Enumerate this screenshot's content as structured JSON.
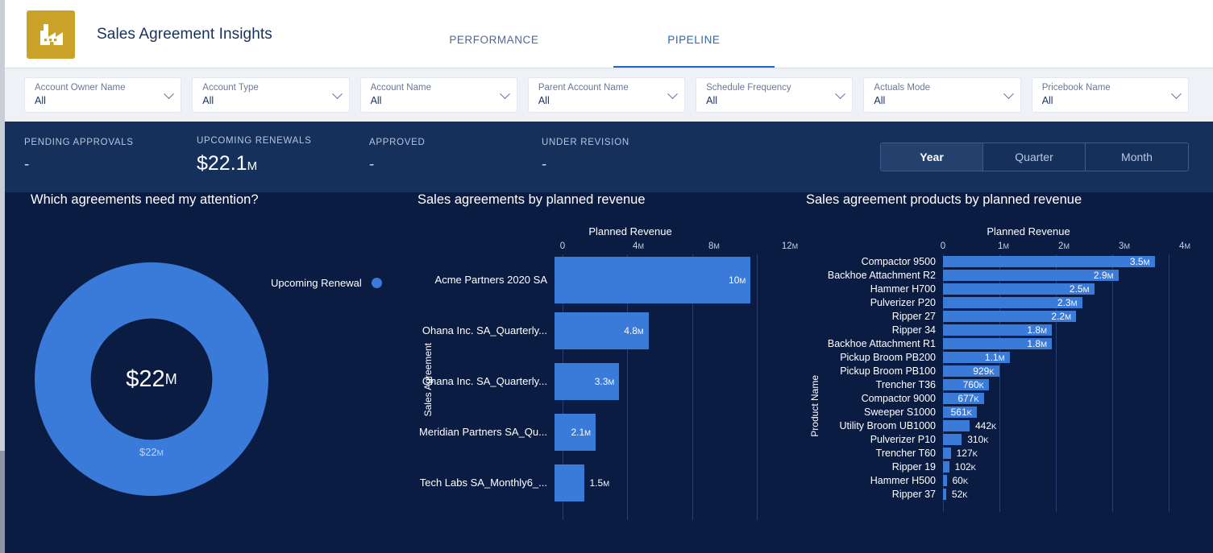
{
  "header": {
    "app_title": "Sales Agreement Insights",
    "brand_icon": "factory-icon",
    "brand_color": "#c9a227",
    "tabs": [
      {
        "label": "PERFORMANCE",
        "active": false
      },
      {
        "label": "PIPELINE",
        "active": true
      }
    ],
    "active_tab_color": "#1b6ac9"
  },
  "filters": [
    {
      "label": "Account Owner Name",
      "value": "All"
    },
    {
      "label": "Account Type",
      "value": "All"
    },
    {
      "label": "Account Name",
      "value": "All"
    },
    {
      "label": "Parent Account Name",
      "value": "All"
    },
    {
      "label": "Schedule Frequency",
      "value": "All"
    },
    {
      "label": "Actuals Mode",
      "value": "All"
    },
    {
      "label": "Pricebook Name",
      "value": "All"
    }
  ],
  "kpis": [
    {
      "label": "PENDING APPROVALS",
      "value": "-",
      "suffix": ""
    },
    {
      "label": "UPCOMING RENEWALS",
      "value": "$22.1",
      "suffix": "M"
    },
    {
      "label": "APPROVED",
      "value": "-",
      "suffix": ""
    },
    {
      "label": "UNDER REVISION",
      "value": "-",
      "suffix": ""
    }
  ],
  "period_toggle": {
    "options": [
      "Year",
      "Quarter",
      "Month"
    ],
    "selected": "Year"
  },
  "panels": {
    "donut_title": "Which agreements need my attention?",
    "agreements_title": "Sales agreements by planned revenue",
    "products_title": "Sales agreement products by planned revenue"
  },
  "chart_data": [
    {
      "type": "pie",
      "title": "Which agreements need my attention?",
      "legend": [
        "Upcoming Renewal"
      ],
      "legend_position": "top-right",
      "center_label": "$22",
      "center_suffix": "M",
      "slices": [
        {
          "name": "Upcoming Renewal",
          "label": "$22",
          "suffix": "M",
          "value": 22000000,
          "percent": 100,
          "color": "#3a7ad9"
        }
      ]
    },
    {
      "type": "bar",
      "orientation": "horizontal",
      "title": "Sales agreements by planned revenue",
      "xlabel": "Planned Revenue",
      "ylabel": "Sales Agreement",
      "xlim": [
        0,
        12000000
      ],
      "xticks": [
        {
          "value": 0,
          "label": "0",
          "suffix": ""
        },
        {
          "value": 4000000,
          "label": "4",
          "suffix": "M"
        },
        {
          "value": 8000000,
          "label": "8",
          "suffix": "M"
        },
        {
          "value": 12000000,
          "label": "12",
          "suffix": "M"
        }
      ],
      "grid": true,
      "bar_color": "#3a7ad9",
      "categories": [
        "Acme Partners 2020 SA",
        "Ohana Inc. SA_Quarterly...",
        "Ohana Inc. SA_Quarterly...",
        "Meridian Partners SA_Qu...",
        "Tech Labs SA_Monthly6_..."
      ],
      "values": [
        10000000,
        4800000,
        3300000,
        2100000,
        1500000
      ],
      "value_labels": [
        {
          "label": "10",
          "suffix": "M",
          "inside": true
        },
        {
          "label": "4.8",
          "suffix": "M",
          "inside": true
        },
        {
          "label": "3.3",
          "suffix": "M",
          "inside": true
        },
        {
          "label": "2.1",
          "suffix": "M",
          "inside": true
        },
        {
          "label": "1.5",
          "suffix": "M",
          "inside": false
        }
      ]
    },
    {
      "type": "bar",
      "orientation": "horizontal",
      "title": "Sales agreement products by planned revenue",
      "xlabel": "Planned Revenue",
      "ylabel": "Product Name",
      "xlim": [
        0,
        4000000
      ],
      "xticks": [
        {
          "value": 0,
          "label": "0",
          "suffix": ""
        },
        {
          "value": 1000000,
          "label": "1",
          "suffix": "M"
        },
        {
          "value": 2000000,
          "label": "2",
          "suffix": "M"
        },
        {
          "value": 3000000,
          "label": "3",
          "suffix": "M"
        },
        {
          "value": 4000000,
          "label": "4",
          "suffix": "M"
        }
      ],
      "grid": true,
      "bar_color": "#3a7ad9",
      "categories": [
        "Compactor 9500",
        "Backhoe Attachment R2",
        "Hammer H700",
        "Pulverizer P20",
        "Ripper 27",
        "Ripper 34",
        "Backhoe Attachment R1",
        "Pickup Broom PB200",
        "Pickup Broom PB100",
        "Trencher T36",
        "Compactor 9000",
        "Sweeper S1000",
        "Utility Broom UB1000",
        "Pulverizer P10",
        "Trencher T60",
        "Ripper 19",
        "Hammer H500",
        "Ripper 37"
      ],
      "values": [
        3500000,
        2900000,
        2500000,
        2300000,
        2200000,
        1800000,
        1800000,
        1100000,
        929000,
        760000,
        677000,
        561000,
        442000,
        310000,
        127000,
        102000,
        60000,
        52000
      ],
      "value_labels": [
        {
          "label": "3.5",
          "suffix": "M",
          "inside": true
        },
        {
          "label": "2.9",
          "suffix": "M",
          "inside": true
        },
        {
          "label": "2.5",
          "suffix": "M",
          "inside": true
        },
        {
          "label": "2.3",
          "suffix": "M",
          "inside": true
        },
        {
          "label": "2.2",
          "suffix": "M",
          "inside": true
        },
        {
          "label": "1.8",
          "suffix": "M",
          "inside": true
        },
        {
          "label": "1.8",
          "suffix": "M",
          "inside": true
        },
        {
          "label": "1.1",
          "suffix": "M",
          "inside": true
        },
        {
          "label": "929",
          "suffix": "K",
          "inside": true
        },
        {
          "label": "760",
          "suffix": "K",
          "inside": true
        },
        {
          "label": "677",
          "suffix": "K",
          "inside": true
        },
        {
          "label": "561",
          "suffix": "K",
          "inside": true
        },
        {
          "label": "442",
          "suffix": "K",
          "inside": false
        },
        {
          "label": "310",
          "suffix": "K",
          "inside": false
        },
        {
          "label": "127",
          "suffix": "K",
          "inside": false
        },
        {
          "label": "102",
          "suffix": "K",
          "inside": false
        },
        {
          "label": "60",
          "suffix": "K",
          "inside": false
        },
        {
          "label": "52",
          "suffix": "K",
          "inside": false
        }
      ]
    }
  ]
}
